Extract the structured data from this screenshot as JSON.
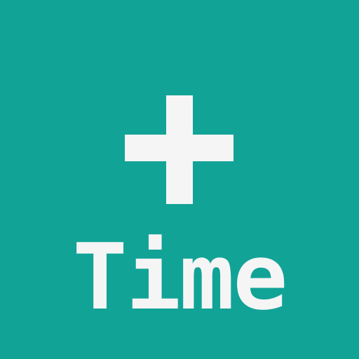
{
  "app_icon": {
    "background_color": "#12a397",
    "foreground_color": "#f5f5f5",
    "icon": "plus-icon",
    "label": "Time"
  }
}
